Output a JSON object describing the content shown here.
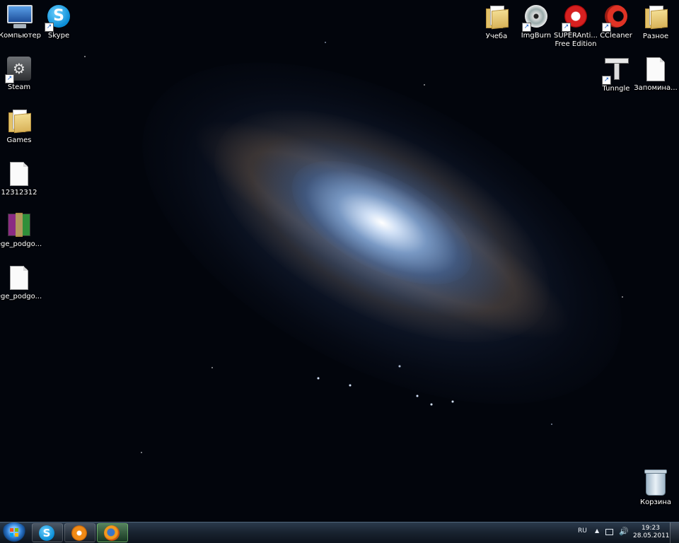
{
  "desktop": {
    "left_column": [
      {
        "label": "Компьютер",
        "icon": "computer-icon"
      },
      {
        "label": "Skype",
        "icon": "skype-icon",
        "shortcut": true
      },
      {
        "label": "Steam",
        "icon": "steam-icon",
        "shortcut": true
      },
      {
        "label": "Games",
        "icon": "folder-icon"
      },
      {
        "label": "12312312",
        "icon": "document-icon"
      },
      {
        "label": "ege_podgo...",
        "icon": "winrar-archive-icon"
      },
      {
        "label": "ege_podgo...",
        "icon": "document-icon"
      }
    ],
    "right_column": [
      {
        "label": "Учеба",
        "icon": "folder-icon"
      },
      {
        "label": "ImgBurn",
        "icon": "disc-icon",
        "shortcut": true
      },
      {
        "label": "SUPERAnti... Free Edition",
        "icon": "superantispyware-icon",
        "shortcut": true
      },
      {
        "label": "CCleaner",
        "icon": "ccleaner-icon",
        "shortcut": true
      },
      {
        "label": "Разное",
        "icon": "folder-icon"
      },
      {
        "label": "Tunngle",
        "icon": "tunngle-icon",
        "shortcut": true
      },
      {
        "label": "Запомина...",
        "icon": "document-icon"
      },
      {
        "label": "Корзина",
        "icon": "recycle-bin-icon"
      }
    ]
  },
  "taskbar": {
    "pinned": [
      {
        "name": "Skype",
        "icon": "skype-icon"
      },
      {
        "name": "VLC",
        "icon": "vlc-icon"
      },
      {
        "name": "Firefox",
        "icon": "firefox-icon"
      }
    ],
    "tray": {
      "language": "RU",
      "overflow_arrow": "▲",
      "volume_glyph": "🔊",
      "time": "19:23",
      "date": "28.05.2011"
    }
  },
  "colors": {
    "taskbar_bg": "#18222f",
    "desktop_bg": "#02050c"
  }
}
